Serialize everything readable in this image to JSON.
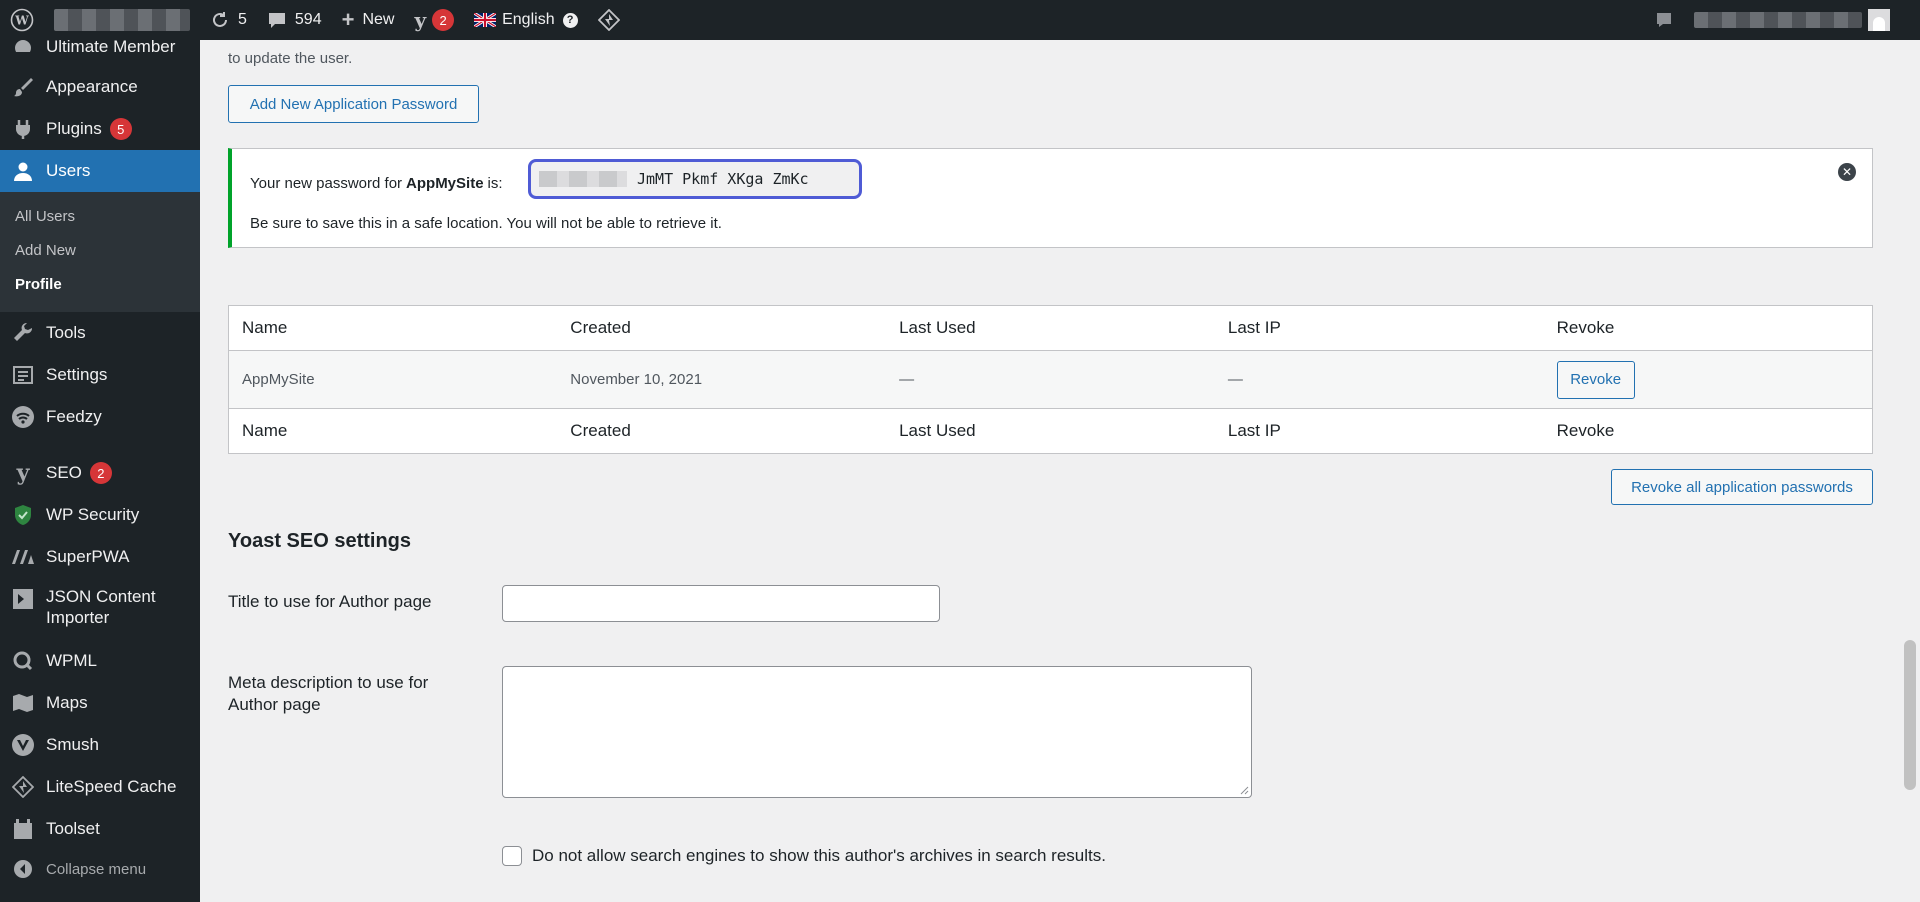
{
  "adminbar": {
    "updates_count": "5",
    "comments_count": "594",
    "new_label": "New",
    "yoast_badge": "2",
    "language": "English"
  },
  "sidebar": {
    "partial_top": "Ultimate Member",
    "items": [
      {
        "label": "Appearance",
        "icon": "paintbrush-icon"
      },
      {
        "label": "Plugins",
        "badge": "5",
        "icon": "plugin-icon"
      },
      {
        "label": "Users",
        "icon": "user-icon",
        "active": true
      },
      {
        "label": "Tools",
        "icon": "wrench-icon"
      },
      {
        "label": "Settings",
        "icon": "settings-icon"
      },
      {
        "label": "Feedzy",
        "icon": "rss-icon"
      },
      {
        "label": "SEO",
        "badge": "2",
        "icon": "yoast-icon"
      },
      {
        "label": "WP Security",
        "icon": "shield-icon"
      },
      {
        "label": "SuperPWA",
        "icon": "pwa-icon"
      },
      {
        "label": "JSON Content Importer",
        "line1": "JSON Content",
        "line2": "Importer",
        "icon": "json-icon"
      },
      {
        "label": "WPML",
        "icon": "wpml-icon"
      },
      {
        "label": "Maps",
        "icon": "map-icon"
      },
      {
        "label": "Smush",
        "icon": "smush-icon"
      },
      {
        "label": "LiteSpeed Cache",
        "icon": "litespeed-icon"
      },
      {
        "label": "Toolset",
        "icon": "toolset-icon"
      }
    ],
    "users_submenu": [
      "All Users",
      "Add New",
      "Profile"
    ],
    "collapse_label": "Collapse menu"
  },
  "main": {
    "partial_desc": "to update the user.",
    "add_button": "Add New Application Password",
    "notice": {
      "prefix": "Your new password for",
      "app_name": "AppMySite",
      "suffix": "is:",
      "password_visible": "JmMT Pkmf XKga ZmKc",
      "warning": "Be sure to save this in a safe location. You will not be able to retrieve it."
    },
    "table": {
      "headers": [
        "Name",
        "Created",
        "Last Used",
        "Last IP",
        "Revoke"
      ],
      "rows": [
        {
          "name": "AppMySite",
          "created": "November 10, 2021",
          "last_used": "—",
          "last_ip": "—",
          "revoke": "Revoke"
        }
      ]
    },
    "revoke_all": "Revoke all application passwords",
    "yoast": {
      "title": "Yoast SEO settings",
      "author_title_label": "Title to use for Author page",
      "meta_label_line1": "Meta description to use for",
      "meta_label_line2": "Author page",
      "noindex_label": "Do not allow search engines to show this author's archives in search results."
    }
  },
  "colors": {
    "adminbar_bg": "#1d2327",
    "accent": "#2271b1",
    "success": "#00a32a",
    "badge": "#d63638",
    "highlight_border": "#4f5bd5"
  }
}
